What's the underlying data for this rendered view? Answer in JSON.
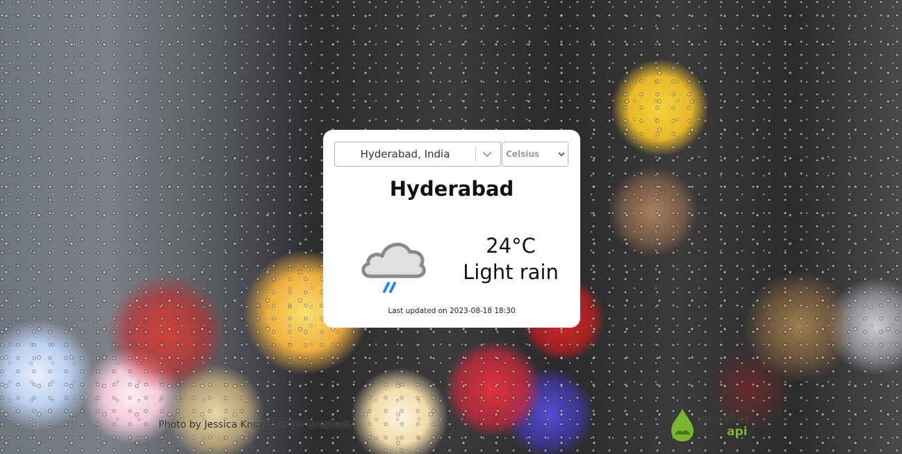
{
  "location_select": {
    "value": "Hyderabad, India"
  },
  "unit_select": {
    "value": "Celsius"
  },
  "weather": {
    "city": "Hyderabad",
    "temperature": "24°C",
    "condition": "Light rain",
    "icon": "cloud-rain-icon",
    "last_updated": "Last updated on 2023-08-18 18:30"
  },
  "footer": {
    "photo_credit": "Photo by Jessica Knowlden on Unsplash",
    "logo": {
      "word": "weather",
      "suffix": "api",
      "accent": "#7ab730"
    }
  },
  "colors": {
    "card_bg": "#ffffff",
    "rain_accent": "#1e88e5",
    "cloud_fill": "#e0e0e0",
    "cloud_outline": "#8a8a8a"
  }
}
